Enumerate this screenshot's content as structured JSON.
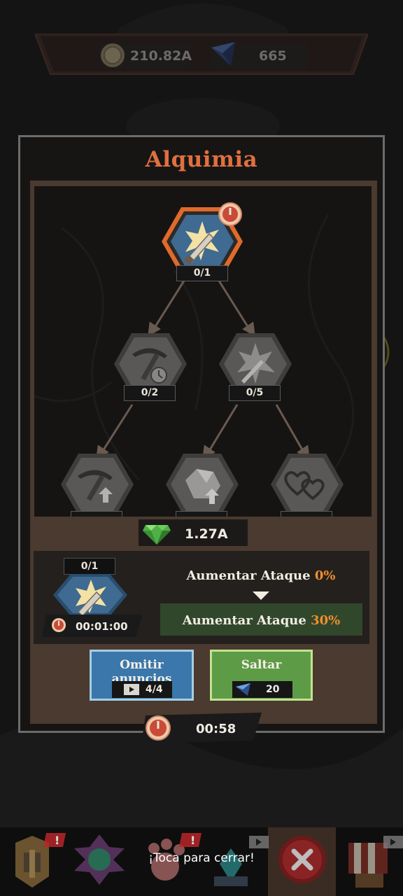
{
  "currency": {
    "coins": "210.82A",
    "gems": "665"
  },
  "panel": {
    "title": "Alquimia"
  },
  "tree": {
    "nodes": [
      {
        "id": "root",
        "label": "0/1",
        "icon": "sword-burst-icon",
        "state": "selected"
      },
      {
        "id": "left",
        "label": "0/2",
        "icon": "pickaxe-clock-icon",
        "state": "locked"
      },
      {
        "id": "right",
        "label": "0/5",
        "icon": "burst-icon",
        "state": "locked"
      },
      {
        "id": "bottom-left",
        "label": "",
        "icon": "pickaxe-arrow-icon",
        "state": "locked"
      },
      {
        "id": "bottom-mid",
        "label": "",
        "icon": "ore-arrow-icon",
        "state": "locked"
      },
      {
        "id": "bottom-right",
        "label": "",
        "icon": "hearts-icon",
        "state": "locked"
      }
    ]
  },
  "cost": {
    "value": "1.27A",
    "icon": "green-gem-icon"
  },
  "detail": {
    "level": "0/1",
    "time": "00:01:00",
    "current_stat": "Aumentar Ataque",
    "current_value": "0%",
    "next_stat": "Aumentar Ataque",
    "next_value": "30%"
  },
  "buttons": {
    "skip_ads": {
      "title": "Omitir anuncios",
      "count": "4/4",
      "icon": "play-ad-icon"
    },
    "skip": {
      "title": "Saltar",
      "cost": "20",
      "icon": "blue-gem-icon"
    }
  },
  "global_timer": "00:58",
  "bottom_nav": {
    "close_hint": "¡Toca para cerrar!"
  },
  "colors": {
    "title": "#e0703f",
    "accent_orange": "#ef8f2d",
    "skip_ads_button": "#3b77aa",
    "skip_button": "#5e9b46",
    "next_stat_bg": "#31472c"
  }
}
